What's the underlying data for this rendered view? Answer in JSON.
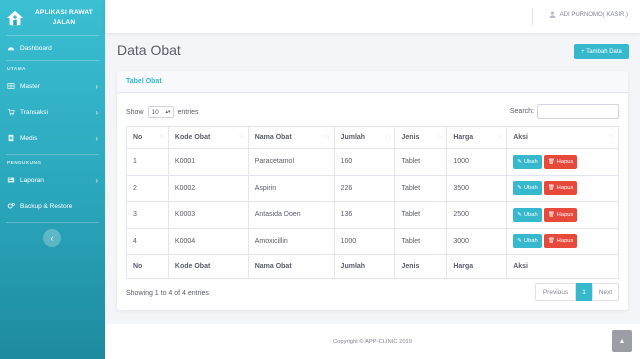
{
  "brand": {
    "line1": "APLIKASI RAWAT",
    "line2": "JALAN"
  },
  "sidebar": {
    "dashboard": "Dashboard",
    "heading_utama": "UTAMA",
    "master": "Master",
    "transaksi": "Transaksi",
    "medis": "Medis",
    "heading_pendukung": "PENDUKUNG",
    "laporan": "Laporan",
    "backup": "Backup & Restore",
    "toggle": "‹"
  },
  "topbar": {
    "user": "ADI PURNOMO( KASIR )"
  },
  "page": {
    "title": "Data Obat",
    "add_button": "+ Tambah Data"
  },
  "card": {
    "title": "Tabel Obat"
  },
  "controls": {
    "show": "Show",
    "entries": "entries",
    "length": "10",
    "search_label": "Search:",
    "search_value": ""
  },
  "table": {
    "headers": [
      "No",
      "Kode Obat",
      "Nama Obat",
      "Jumlah",
      "Jenis",
      "Harga",
      "Aksi"
    ],
    "rows": [
      [
        "1",
        "K0001",
        "Paracetamol",
        "160",
        "Tablet",
        "1000"
      ],
      [
        "2",
        "K0002",
        "Aspirin",
        "226",
        "Tablet",
        "3500"
      ],
      [
        "3",
        "K0003",
        "Antasida Doen",
        "136",
        "Tablet",
        "2500"
      ],
      [
        "4",
        "K0004",
        "Amoxicillin",
        "1000",
        "Tablet",
        "3000"
      ]
    ],
    "ubah": "Ubah",
    "hapus": "Hapus"
  },
  "info": "Showing 1 to 4 of 4 entries",
  "pager": {
    "prev": "Previous",
    "current": "1",
    "next": "Next"
  },
  "footer": "Copyright © APP-CLINIC 2019",
  "colors": {
    "primary": "#36b9cc",
    "danger": "#e74a3b",
    "sidebar_top": "#3bbfd3",
    "sidebar_bottom": "#1d8a9f"
  }
}
